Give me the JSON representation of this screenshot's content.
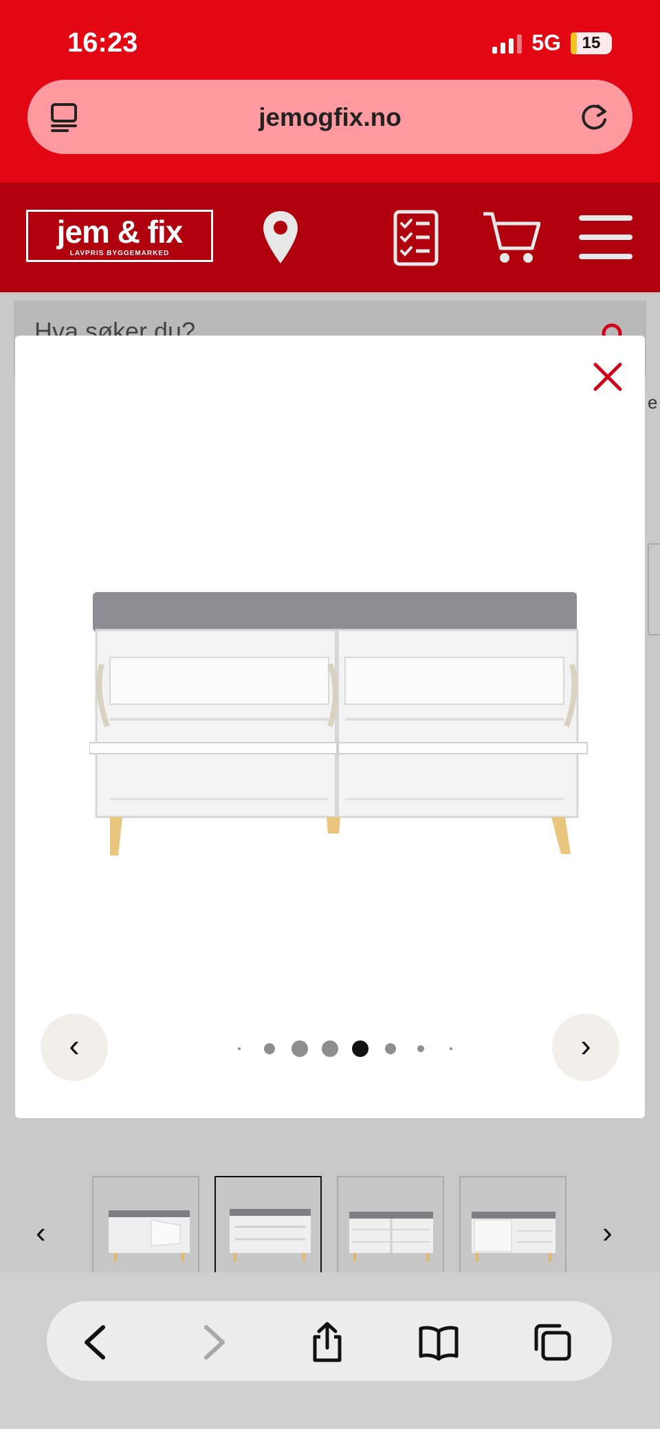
{
  "status_bar": {
    "time": "16:23",
    "network": "5G",
    "battery": "15",
    "battery_level": 0.15
  },
  "browser": {
    "url": "jemogfix.no"
  },
  "header": {
    "logo_main": "jem & fix",
    "logo_sub": "LAVPRIS BYGGEMARKED"
  },
  "search": {
    "placeholder": "Hva søker du?"
  },
  "background_fragment": "e",
  "gallery": {
    "prev_label": "‹",
    "next_label": "›",
    "dots": 8,
    "active_dot": 4
  },
  "thumbnails": {
    "prev_label": "‹",
    "next_label": "›",
    "count": 4,
    "active_index": 1
  },
  "colors": {
    "brand_red": "#e30613",
    "header_red": "#b0000d",
    "close_red": "#d0021b"
  }
}
